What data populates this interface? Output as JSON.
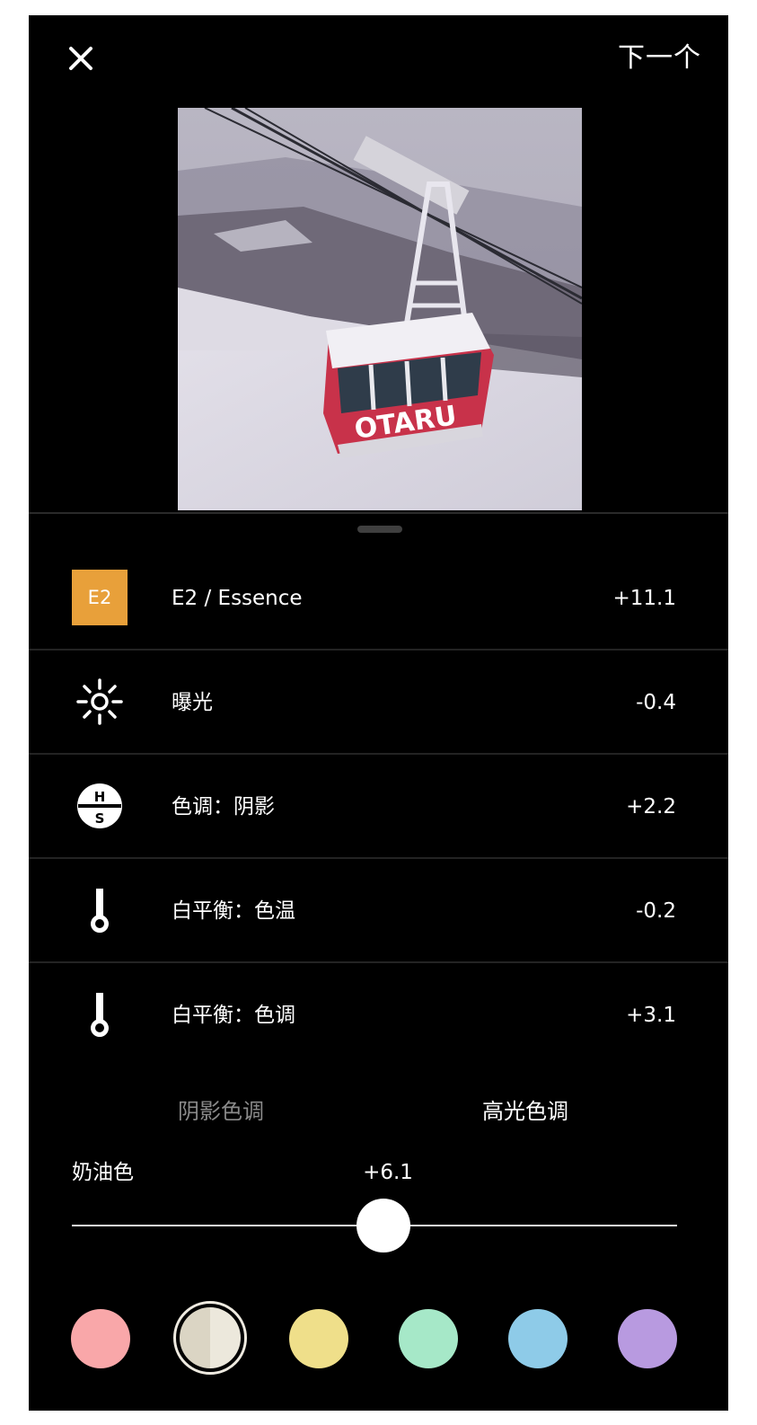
{
  "topbar": {
    "close_symbol": "✕",
    "next_label": "下一个"
  },
  "photo": {
    "caption_text": "OTARU"
  },
  "adjustments": [
    {
      "icon": "preset-badge",
      "badge": "E2",
      "label": "E2 / Essence",
      "value": "+11.1"
    },
    {
      "icon": "sun-icon",
      "label": "曝光",
      "value": "-0.4"
    },
    {
      "icon": "hsl-icon",
      "icon_top": "H",
      "icon_bottom": "S",
      "label": "色调：阴影",
      "value": "+2.2"
    },
    {
      "icon": "thermometer-icon",
      "label": "白平衡：色温",
      "value": "-0.2"
    },
    {
      "icon": "thermometer-icon",
      "label": "白平衡：色调",
      "value": "+3.1"
    }
  ],
  "tone_tabs": {
    "shadows": "阴影色调",
    "highlights": "高光色调",
    "active": "highlights"
  },
  "slider": {
    "name": "奶油色",
    "value": "+6.1",
    "level_percent": 51.5
  },
  "swatches": [
    {
      "name": "red",
      "color": "#f9a7a9"
    },
    {
      "name": "cream",
      "color": "#e2dccb",
      "selected": true
    },
    {
      "name": "yellow",
      "color": "#efdf8a"
    },
    {
      "name": "green",
      "color": "#a6e8c8"
    },
    {
      "name": "blue",
      "color": "#8ecbe8"
    },
    {
      "name": "purple",
      "color": "#b89ae0"
    }
  ],
  "colors": {
    "background": "#000000",
    "accent_badge": "#e8a03a",
    "text": "#ffffff",
    "inactive_tab": "#8a8a8a"
  }
}
